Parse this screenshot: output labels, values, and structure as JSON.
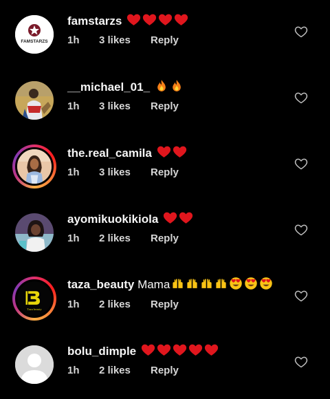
{
  "colors": {
    "background": "#000000",
    "text": "#f5f5f5",
    "meta_text": "#d6d6d6",
    "emoji_heart": "#e0161d",
    "emoji_fire": "#f57f17",
    "emoji_hands": "#f9c315"
  },
  "comments": [
    {
      "username": "famstarzs",
      "text": "",
      "emojis": [
        "red-heart",
        "red-heart",
        "red-heart",
        "red-heart"
      ],
      "time": "1h",
      "likes": "3 likes",
      "reply_label": "Reply",
      "avatar_label": "FAMSTARZS",
      "has_story_ring": false
    },
    {
      "username": "__michael_01_",
      "text": "",
      "emojis": [
        "fire",
        "fire"
      ],
      "time": "1h",
      "likes": "3 likes",
      "reply_label": "Reply",
      "has_story_ring": false
    },
    {
      "username": "the.real_camila",
      "text": "",
      "emojis": [
        "red-heart",
        "red-heart"
      ],
      "time": "1h",
      "likes": "3 likes",
      "reply_label": "Reply",
      "has_story_ring": true
    },
    {
      "username": "ayomikuokikiola",
      "text": "",
      "emojis": [
        "red-heart",
        "red-heart"
      ],
      "time": "1h",
      "likes": "2 likes",
      "reply_label": "Reply",
      "has_story_ring": false
    },
    {
      "username": "taza_beauty",
      "text": "Mama",
      "emojis": [
        "raising-hands",
        "raising-hands",
        "raising-hands",
        "raising-hands",
        "heart-eyes",
        "heart-eyes",
        "heart-eyes"
      ],
      "time": "1h",
      "likes": "2 likes",
      "reply_label": "Reply",
      "avatar_label": "Taza beauty",
      "has_story_ring": true
    },
    {
      "username": "bolu_dimple",
      "text": "",
      "emojis": [
        "red-heart",
        "red-heart",
        "red-heart",
        "red-heart",
        "red-heart"
      ],
      "time": "1h",
      "likes": "2 likes",
      "reply_label": "Reply",
      "has_story_ring": false
    }
  ]
}
